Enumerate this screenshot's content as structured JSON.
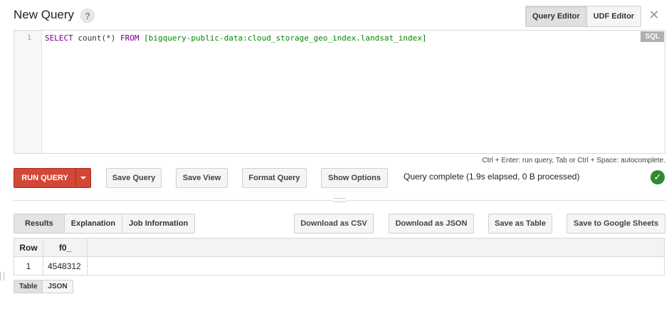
{
  "header": {
    "title": "New Query",
    "help_glyph": "?",
    "editor_tabs": [
      {
        "label": "Query Editor",
        "active": true
      },
      {
        "label": "UDF Editor",
        "active": false
      }
    ],
    "close_glyph": "✕"
  },
  "editor": {
    "line_number": "1",
    "code": {
      "select_kw": "SELECT",
      "fn": "count(*)",
      "from_kw": "FROM",
      "table": "[bigquery-public-data:cloud_storage_geo_index.landsat_index]"
    },
    "language_badge": "SQL",
    "hint": "Ctrl + Enter: run query, Tab or Ctrl + Space: autocomplete."
  },
  "actions": {
    "run_label": "RUN QUERY",
    "save_query": "Save Query",
    "save_view": "Save View",
    "format_query": "Format Query",
    "show_options": "Show Options",
    "status": "Query complete (1.9s elapsed, 0 B processed)",
    "status_glyph": "✓"
  },
  "results": {
    "tabs": [
      {
        "label": "Results",
        "active": true
      },
      {
        "label": "Explanation",
        "active": false
      },
      {
        "label": "Job Information",
        "active": false
      }
    ],
    "download_csv": "Download as CSV",
    "download_json": "Download as JSON",
    "save_table": "Save as Table",
    "save_sheets": "Save to Google Sheets",
    "columns": [
      "Row",
      "f0_"
    ],
    "rows": [
      {
        "row": "1",
        "f0_": "4548312"
      }
    ],
    "view_tabs": [
      {
        "label": "Table",
        "active": true
      },
      {
        "label": "JSON",
        "active": false
      }
    ]
  },
  "colors": {
    "run_button": "#d14836",
    "success": "#2e8b35"
  }
}
